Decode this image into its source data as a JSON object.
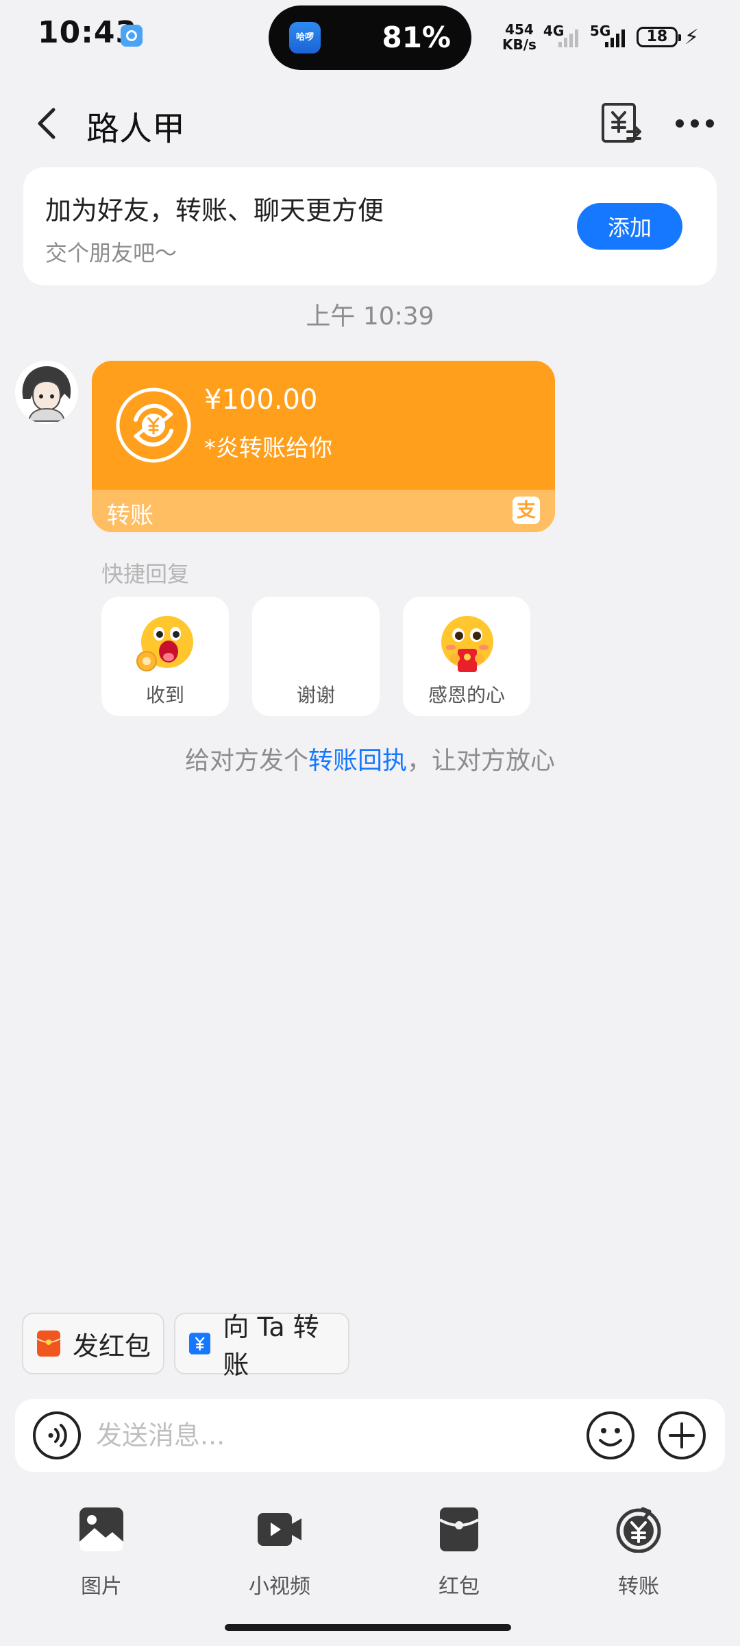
{
  "status_bar": {
    "time": "10:43",
    "island_app": "哈啰",
    "island_text": "81%",
    "net_speed_value": "454",
    "net_speed_unit": "KB/s",
    "signal1_label": "4G",
    "signal2_label": "5G",
    "battery": "18"
  },
  "header": {
    "title": "路人甲"
  },
  "friend_card": {
    "title": "加为好友，转账、聊天更方便",
    "subtitle": "交个朋友吧～",
    "add_label": "添加"
  },
  "timestamp": "上午 10:39",
  "transfer": {
    "amount": "¥100.00",
    "note": "*炎转账给你",
    "label": "转账",
    "brand_icon": "alipay-icon"
  },
  "quick_reply": {
    "title": "快捷回复",
    "items": [
      {
        "label": "收到",
        "icon": "ok-emoji-icon"
      },
      {
        "label": "谢谢",
        "icon": ""
      },
      {
        "label": "感恩的心",
        "icon": "red-envelope-emoji-icon"
      }
    ]
  },
  "receipt_hint": {
    "pre": "给对方发个",
    "link": "转账回执",
    "post": "，让对方放心"
  },
  "chips": [
    {
      "label": "发红包",
      "color": "#F0561D"
    },
    {
      "label": "向 Ta 转账",
      "color": "#1677FF"
    }
  ],
  "input": {
    "placeholder": "发送消息..."
  },
  "toolbar": [
    {
      "label": "图片",
      "icon": "image-icon"
    },
    {
      "label": "小视频",
      "icon": "video-icon"
    },
    {
      "label": "红包",
      "icon": "red-envelope-icon"
    },
    {
      "label": "转账",
      "icon": "transfer-icon"
    }
  ],
  "colors": {
    "accent": "#1677FF",
    "transfer_orange": "#FF9F1C",
    "background": "#F2F2F4"
  }
}
